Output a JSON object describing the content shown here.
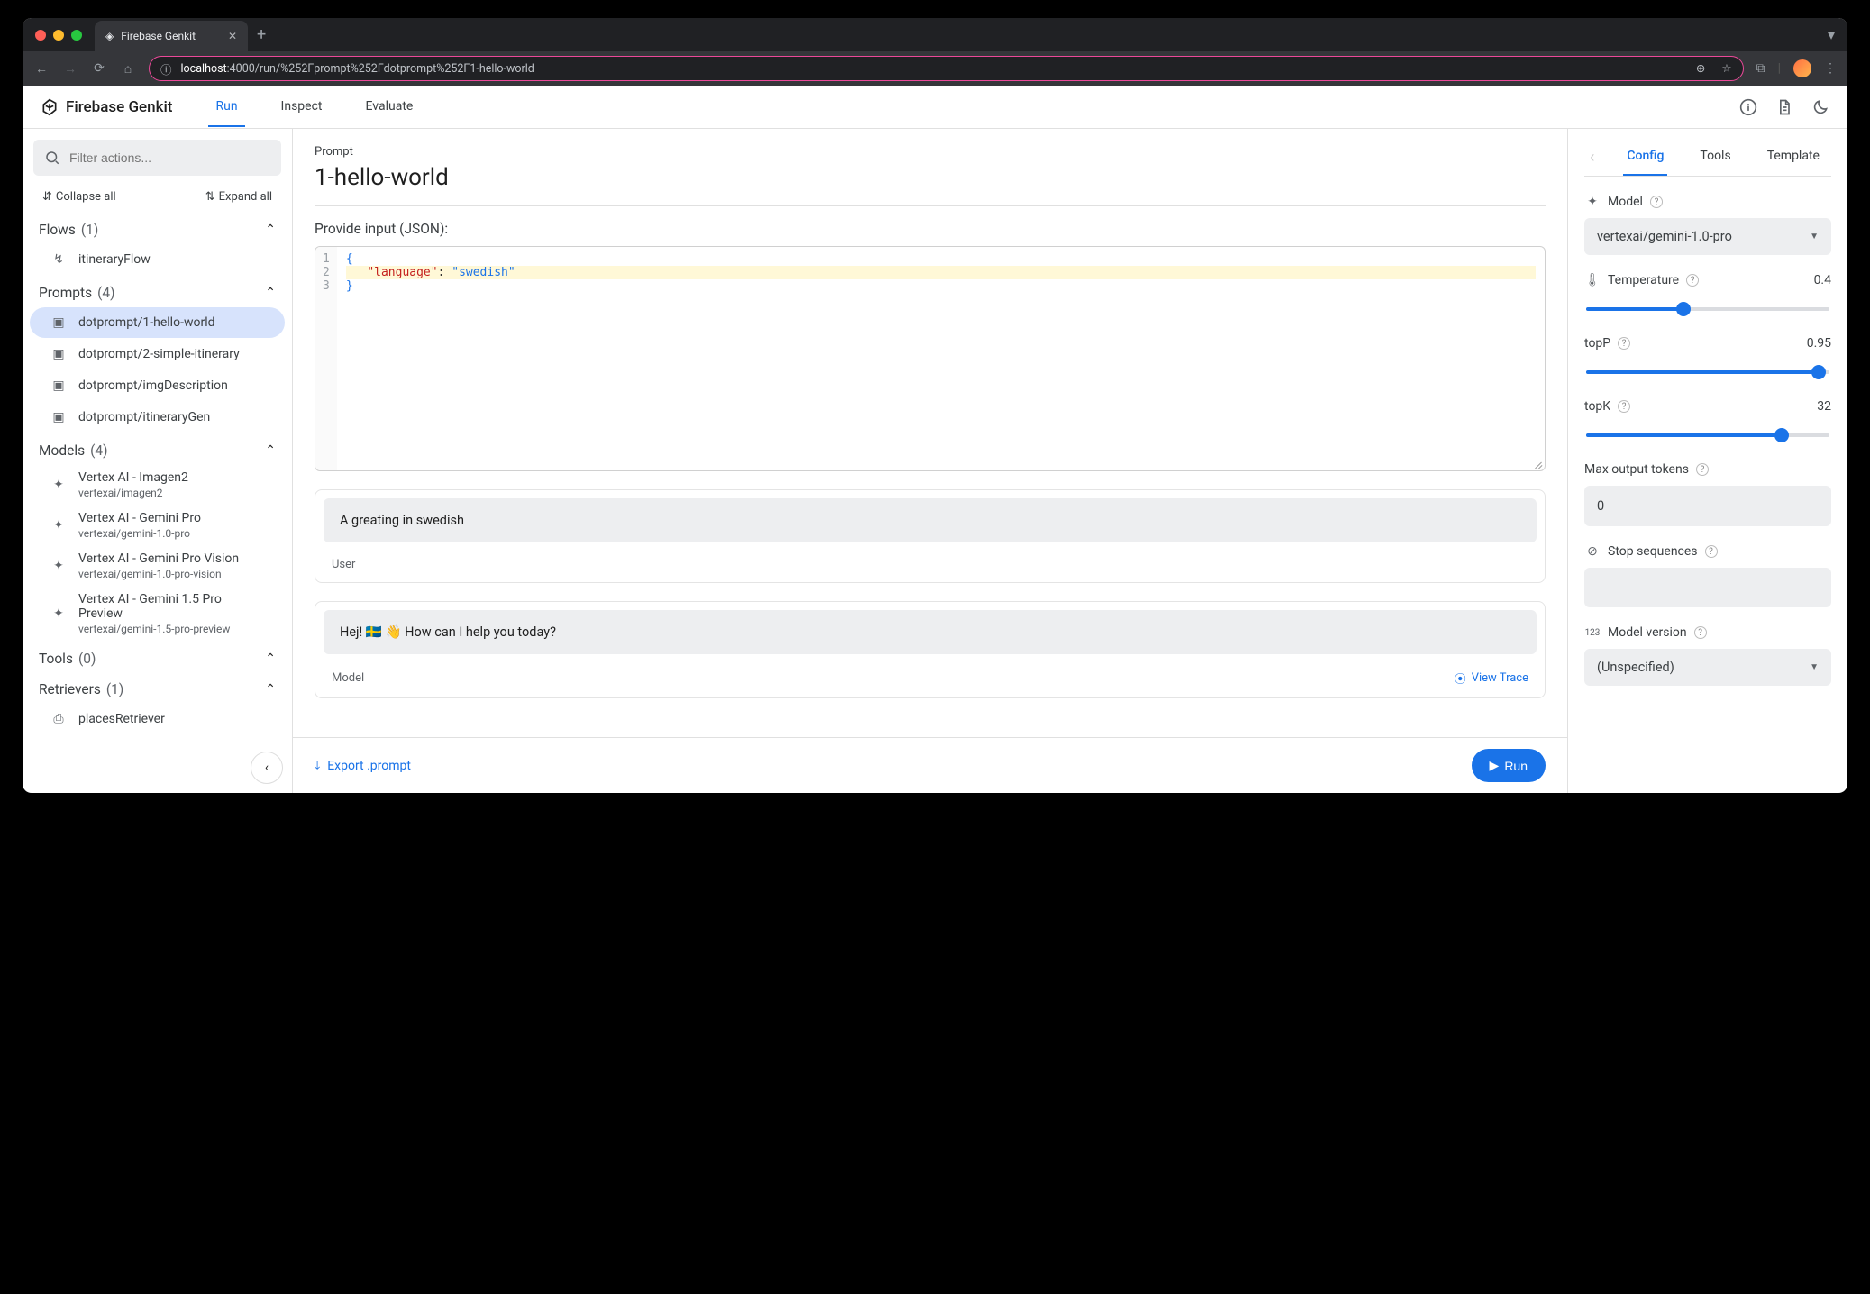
{
  "browser": {
    "tab_title": "Firebase Genkit",
    "url_host": "localhost",
    "url_port": ":4000",
    "url_path": "/run/%252Fprompt%252Fdotprompt%252F1-hello-world"
  },
  "app": {
    "title": "Firebase Genkit",
    "tabs": [
      "Run",
      "Inspect",
      "Evaluate"
    ]
  },
  "sidebar": {
    "filter_placeholder": "Filter actions...",
    "collapse_all": "Collapse all",
    "expand_all": "Expand all",
    "sections": {
      "flows": {
        "label": "Flows",
        "count": "(1)",
        "items": [
          "itineraryFlow"
        ]
      },
      "prompts": {
        "label": "Prompts",
        "count": "(4)",
        "items": [
          "dotprompt/1-hello-world",
          "dotprompt/2-simple-itinerary",
          "dotprompt/imgDescription",
          "dotprompt/itineraryGen"
        ]
      },
      "models": {
        "label": "Models",
        "count": "(4)",
        "items": [
          {
            "name": "Vertex AI - Imagen2",
            "id": "vertexai/imagen2"
          },
          {
            "name": "Vertex AI - Gemini Pro",
            "id": "vertexai/gemini-1.0-pro"
          },
          {
            "name": "Vertex AI - Gemini Pro Vision",
            "id": "vertexai/gemini-1.0-pro-vision"
          },
          {
            "name": "Vertex AI - Gemini 1.5 Pro Preview",
            "id": "vertexai/gemini-1.5-pro-preview"
          }
        ]
      },
      "tools": {
        "label": "Tools",
        "count": "(0)"
      },
      "retrievers": {
        "label": "Retrievers",
        "count": "(1)",
        "items": [
          "placesRetriever"
        ]
      }
    }
  },
  "main": {
    "prompt_label": "Prompt",
    "prompt_name": "1-hello-world",
    "input_label": "Provide input (JSON):",
    "code_lines": {
      "l1_brace": "{",
      "l2_key": "\"language\"",
      "l2_colon": ": ",
      "l2_val": "\"swedish\"",
      "l3_brace": "}"
    },
    "greeting_text": "A greating in swedish",
    "greeting_role": "User",
    "response_text": "Hej! 🇸🇪 👋 How can I help you today?",
    "response_role": "Model",
    "view_trace": "View Trace",
    "export_label": "Export .prompt",
    "run_label": "Run"
  },
  "config": {
    "tabs": [
      "Config",
      "Tools",
      "Template"
    ],
    "model_label": "Model",
    "model_selected": "vertexai/gemini-1.0-pro",
    "temperature_label": "Temperature",
    "temperature_value": "0.4",
    "temperature_pct": 40,
    "topp_label": "topP",
    "topp_value": "0.95",
    "topp_pct": 95,
    "topk_label": "topK",
    "topk_value": "32",
    "topk_pct": 80,
    "max_tokens_label": "Max output tokens",
    "max_tokens_value": "0",
    "stop_label": "Stop sequences",
    "version_label": "Model version",
    "version_value": "(Unspecified)"
  }
}
